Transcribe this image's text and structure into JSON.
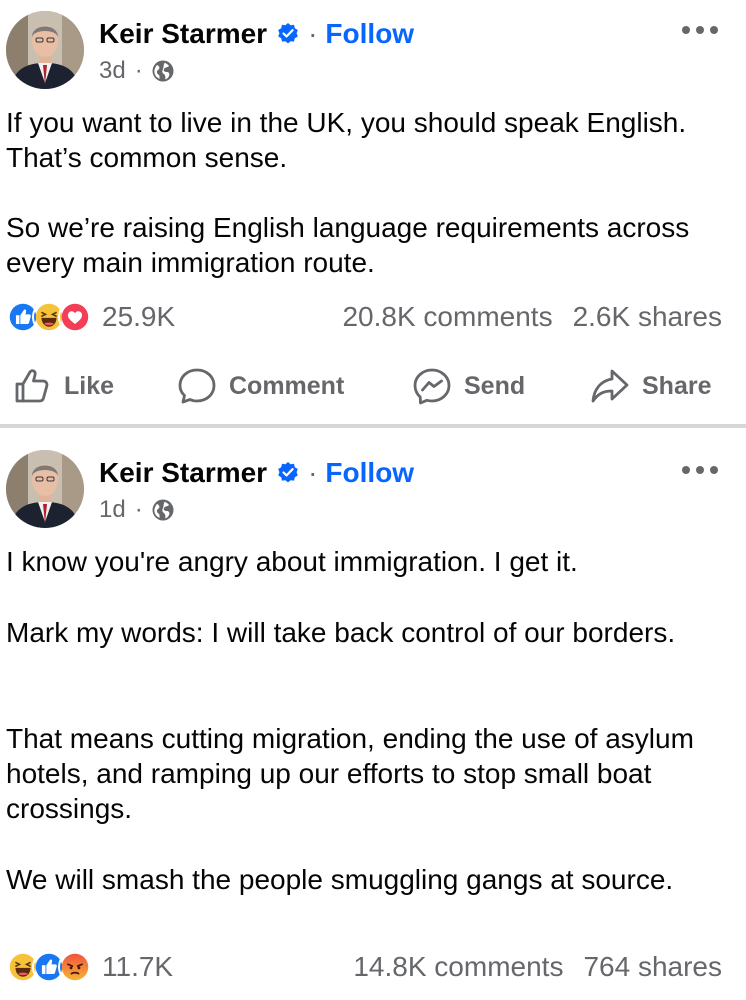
{
  "colors": {
    "accent": "#0866ff",
    "secondary_text": "#65676b",
    "primary_text": "#050505",
    "like_blue": "#1877f2",
    "love_red": "#f33e58",
    "angry_orange": "#e9710f"
  },
  "posts": [
    {
      "author": "Keir Starmer",
      "follow_label": "Follow",
      "separator": "·",
      "time": "3d",
      "audience_icon": "globe-icon",
      "paragraphs": [
        "If you want to live in the UK, you should speak English. That’s common sense.",
        "So we’re raising English language requirements across every main immigration route."
      ],
      "reactions": [
        "like",
        "haha",
        "love"
      ],
      "reaction_count": "25.9K",
      "comments": "20.8K comments",
      "shares": "2.6K shares",
      "actions": {
        "like": "Like",
        "comment": "Comment",
        "send": "Send",
        "share": "Share"
      }
    },
    {
      "author": "Keir Starmer",
      "follow_label": "Follow",
      "separator": "·",
      "time": "1d",
      "audience_icon": "globe-icon",
      "paragraphs": [
        "I know you're angry about immigration. I get it.",
        "Mark my words: I will take back control of our borders.",
        "That means cutting migration, ending the use of asylum hotels, and ramping up our efforts to stop small boat crossings.",
        "We will smash the people smuggling gangs at source."
      ],
      "reactions": [
        "haha",
        "like",
        "angry"
      ],
      "reaction_count": "11.7K",
      "comments": "14.8K comments",
      "shares": "764 shares"
    }
  ]
}
